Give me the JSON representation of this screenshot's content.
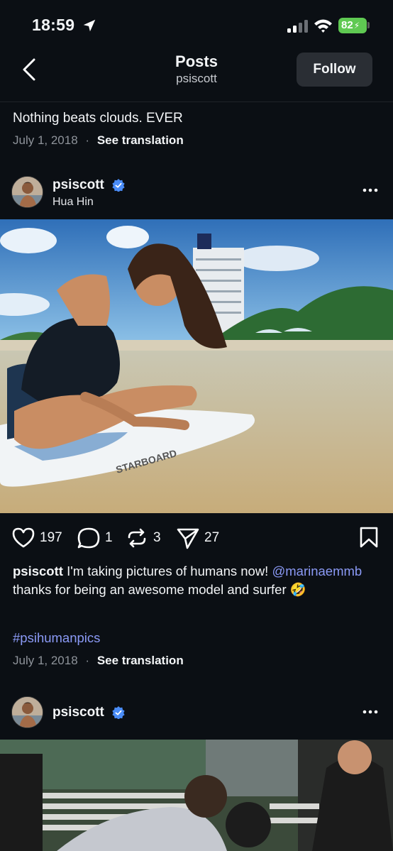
{
  "status_bar": {
    "time": "18:59",
    "battery": "82"
  },
  "header": {
    "title": "Posts",
    "subtitle": "psiscott",
    "follow_label": "Follow"
  },
  "prev_post": {
    "caption": "Nothing beats clouds. EVER",
    "date": "July 1, 2018",
    "dot": "·",
    "translate": "See translation"
  },
  "post1": {
    "username": "psiscott",
    "location": "Hua Hin",
    "likes": "197",
    "comments": "1",
    "reposts": "3",
    "shares": "27",
    "caption_user": "psiscott",
    "caption_text": " I'm taking pictures of humans now! ",
    "mention": "@marinaemmb",
    "caption_text2": "  thanks for being an awesome model and surfer 🤣",
    "hashtag": "#psihumanpics",
    "date": "July 1, 2018",
    "dot": "·",
    "translate": "See translation",
    "board_text": "STARBOARD"
  },
  "post2": {
    "username": "psiscott"
  },
  "colors": {
    "background": "#0b0f14",
    "link": "#8b9af6",
    "verified": "#4a8cf7",
    "battery": "#5fc952"
  }
}
